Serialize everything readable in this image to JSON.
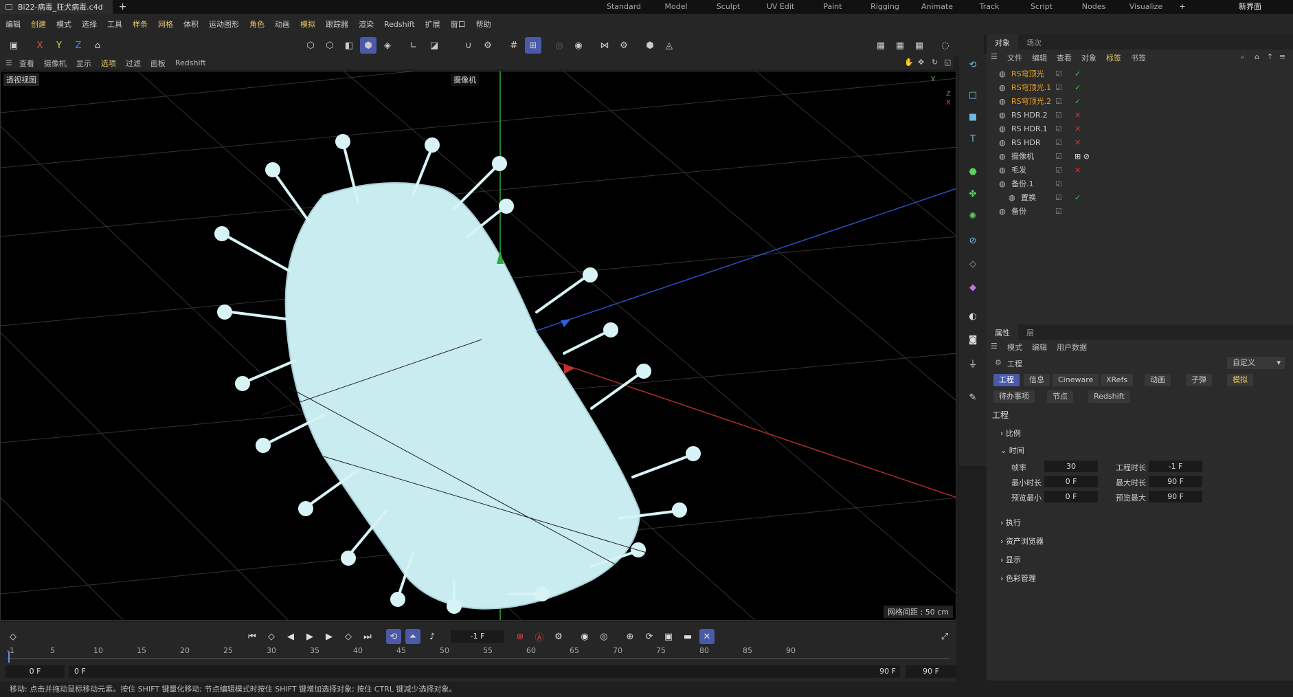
{
  "title_tab": "Bi22-病毒_狂犬病毒.c4d",
  "layouts": [
    "Standard",
    "Model",
    "Sculpt",
    "UV Edit",
    "Paint",
    "Rigging",
    "Animate",
    "Track",
    "Script",
    "Nodes",
    "Visualize"
  ],
  "new_ui": "新界面",
  "menu": [
    "编辑",
    "创建",
    "模式",
    "选择",
    "工具",
    "样条",
    "网格",
    "体积",
    "运动图形",
    "角色",
    "动画",
    "模拟",
    "跟踪器",
    "渲染",
    "Redshift",
    "扩展",
    "窗口",
    "帮助"
  ],
  "axis_btns": [
    "X",
    "Y",
    "Z"
  ],
  "view_menu": [
    "查看",
    "摄像机",
    "显示",
    "选项",
    "过滤",
    "面板",
    "Redshift"
  ],
  "viewport": {
    "title": "透视视图",
    "camera": "摄像机",
    "grid": "网格间距 : 50 cm"
  },
  "obj_tabs": [
    "对象",
    "场次"
  ],
  "obj_menu": [
    "文件",
    "编辑",
    "查看",
    "对象",
    "标签",
    "书签"
  ],
  "objects": [
    {
      "name": "RS穹顶光",
      "orange": true,
      "state": "ok"
    },
    {
      "name": "RS穹顶光.1",
      "orange": true,
      "state": "ok"
    },
    {
      "name": "RS穹顶光.2",
      "orange": true,
      "state": "ok"
    },
    {
      "name": "RS HDR.2",
      "orange": false,
      "state": "x"
    },
    {
      "name": "RS HDR.1",
      "orange": false,
      "state": "x"
    },
    {
      "name": "RS HDR",
      "orange": false,
      "state": "x"
    },
    {
      "name": "摄像机",
      "orange": false,
      "state": "cam"
    },
    {
      "name": "毛发",
      "orange": false,
      "state": "x"
    },
    {
      "name": "备份.1",
      "orange": false,
      "state": ""
    },
    {
      "name": "置换",
      "orange": false,
      "state": "ok"
    },
    {
      "name": "备份",
      "orange": false,
      "state": ""
    }
  ],
  "attr_tabs": [
    "属性",
    "层"
  ],
  "attr_menu": [
    "模式",
    "编辑",
    "用户数据"
  ],
  "attr_title": "工程",
  "attr_dropdown": "自定义",
  "attr_pills_row1": [
    "工程",
    "信息",
    "Cineware",
    "XRefs",
    "动画",
    "子弹",
    "模拟"
  ],
  "attr_pills_row2": [
    "待办事项",
    "节点",
    "Redshift"
  ],
  "section_title": "工程",
  "groups": {
    "scale": "比例",
    "time": "时间",
    "exec": "执行",
    "assets": "资产浏览器",
    "display": "显示",
    "color": "色彩管理"
  },
  "time_fields": {
    "fps_label": "帧率",
    "fps": "30",
    "proj_len_label": "工程时长",
    "proj_len": "-1 F",
    "min_label": "最小时长",
    "min": "0 F",
    "max_label": "最大时长",
    "max": "90 F",
    "pmin_label": "预览最小",
    "pmin": "0 F",
    "pmax_label": "预览最大",
    "pmax": "90 F"
  },
  "timeline": {
    "current": "-1 F",
    "ticks": [
      "-1",
      "5",
      "10",
      "15",
      "20",
      "25",
      "30",
      "35",
      "40",
      "45",
      "50",
      "55",
      "60",
      "65",
      "70",
      "75",
      "80",
      "85",
      "90"
    ],
    "start": "0 F",
    "start2": "0 F",
    "end": "90 F",
    "end2": "90 F"
  },
  "status": "移动: 点击并拖动鼠标移动元素。按住 SHIFT 键量化移动; 节点编辑模式时按住 SHIFT 键增加选择对象; 按住 CTRL 键减少选择对象。"
}
